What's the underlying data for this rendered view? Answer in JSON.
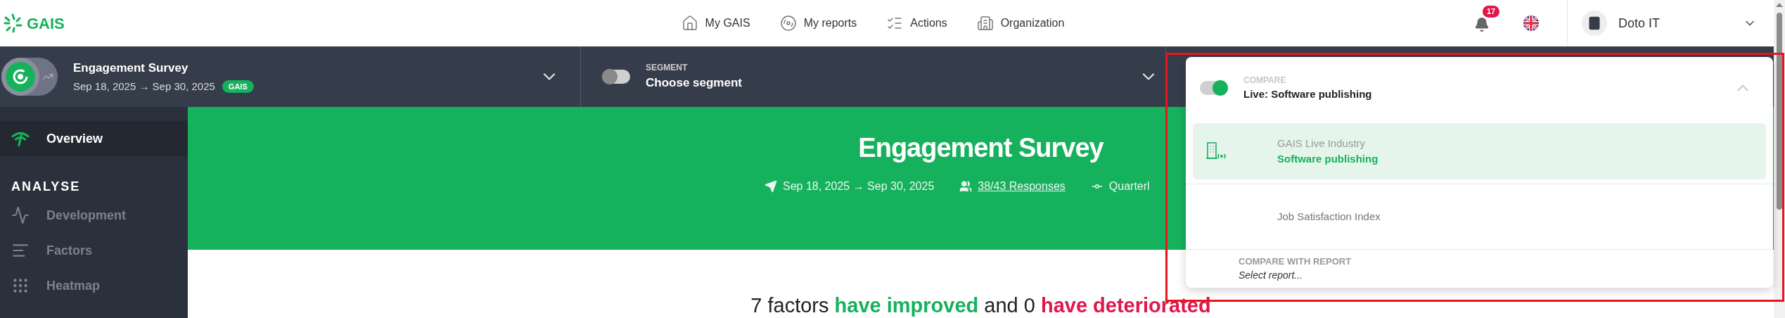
{
  "header": {
    "logo": "GAIS",
    "nav": [
      {
        "label": "My GAIS"
      },
      {
        "label": "My reports"
      },
      {
        "label": "Actions"
      },
      {
        "label": "Organization"
      }
    ],
    "notifications": {
      "count": "17"
    },
    "account": {
      "name": "Doto IT"
    }
  },
  "survey_selector": {
    "title": "Engagement Survey",
    "dates": "Sep 18, 2025 → Sep 30, 2025",
    "badge": "GAIS"
  },
  "segment": {
    "label": "SEGMENT",
    "value": "Choose segment",
    "on": false
  },
  "compare": {
    "label": "COMPARE",
    "value": "Live: Software publishing",
    "on": true,
    "expanded": true,
    "options": [
      {
        "kind": "industry",
        "group": "GAIS Live Industry",
        "label": "Software publishing",
        "selected": true
      },
      {
        "kind": "index",
        "label": "Job Satisfaction Index",
        "selected": false
      }
    ],
    "report": {
      "label": "COMPARE WITH REPORT",
      "placeholder": "Select report..."
    }
  },
  "sidebar": {
    "items": [
      {
        "kind": "item",
        "label": "Overview",
        "selected": true
      },
      {
        "kind": "heading",
        "label": "ANALYSE"
      },
      {
        "kind": "item",
        "label": "Development",
        "selected": false
      },
      {
        "kind": "item",
        "label": "Factors",
        "selected": false
      },
      {
        "kind": "item",
        "label": "Heatmap",
        "selected": false
      }
    ]
  },
  "banner": {
    "title": "Engagement Survey",
    "meta": [
      {
        "kind": "dates",
        "text": "Sep 18, 2025 → Sep 30, 2025"
      },
      {
        "kind": "responses",
        "text": "38/43 Responses"
      },
      {
        "kind": "frequency",
        "text": "Quarterl"
      }
    ]
  },
  "summary": [
    {
      "text": "7 factors ",
      "kind": "plain"
    },
    {
      "text": "have improved",
      "kind": "positive"
    },
    {
      "text": " and 0 ",
      "kind": "plain"
    },
    {
      "text": "have deteriorated",
      "kind": "negative"
    }
  ]
}
